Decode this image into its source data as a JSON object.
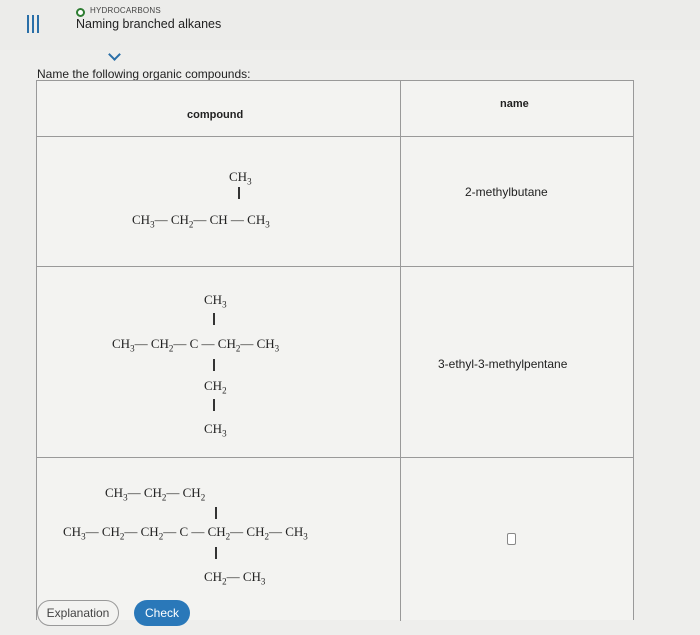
{
  "header": {
    "category": "HYDROCARBONS",
    "title": "Naming branched alkanes"
  },
  "prompt": "Name the following organic compounds:",
  "table": {
    "col_compound": "compound",
    "col_name": "name",
    "rows": [
      {
        "answer": "2-methylbutane"
      },
      {
        "answer": "3-ethyl-3-methylpentane"
      },
      {
        "answer": ""
      }
    ]
  },
  "buttons": {
    "explanation": "Explanation",
    "check": "Check"
  },
  "colors": {
    "accent": "#2a78b9",
    "status": "#2e7d32"
  }
}
